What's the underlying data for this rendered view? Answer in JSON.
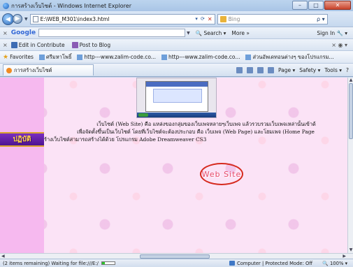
{
  "window": {
    "title": "การสร้างเว็บไซต์ - Windows Internet Explorer"
  },
  "address": {
    "url": "E:\\WEB_M301\\index3.html",
    "search_placeholder": "Bing"
  },
  "google_toolbar": {
    "brand": "Google",
    "search_label": "Search",
    "more_label": "More »",
    "signin_label": "Sign In"
  },
  "contribute_toolbar": {
    "edit_label": "Edit in Contribute",
    "post_label": "Post to Blog"
  },
  "favorites_bar": {
    "label": "Favorites",
    "items": [
      "ศรีมหาโพธิ์",
      "http---www.zalim-code.co...",
      "http---www.zalim-code.co...",
      "ส่วนอัพเดทอนต่างๆ ของโปรแกรม..."
    ]
  },
  "tabs": [
    {
      "label": "การสร้างเว็บไซต์"
    }
  ],
  "command_bar": {
    "page": "Page ▾",
    "safety": "Safety ▾",
    "tools": "Tools ▾"
  },
  "page": {
    "nav_label": "ปฏิบัติ",
    "lines": [
      "เว็บไซต์ (Web Site) คือ แหล่งของกลุ่มของเว็บเพจหลายๆเว็บเพจ แล้วรวบรวมเว็บเพจเหล่านั้นเข้าด้",
      "เพื่อจัดตั้งขึ้นเป็นเว็บไซต์ โดยที่เว็บไซต์จะต้องประกอบ คือ เว็บเพจ (Web Page) และโฮมเพจ (Home Page",
      "ร้างเว็บไซต์สามารถสร้างได้ด้วย โปรแกรม Adobe Dreamweaver CS3"
    ],
    "highlight": "Web Site"
  },
  "status": {
    "text": "(2 items remaining) Waiting for file:///E:/",
    "progress": 0.2,
    "zone": "Computer | Protected Mode: Off",
    "zoom": "100%"
  }
}
